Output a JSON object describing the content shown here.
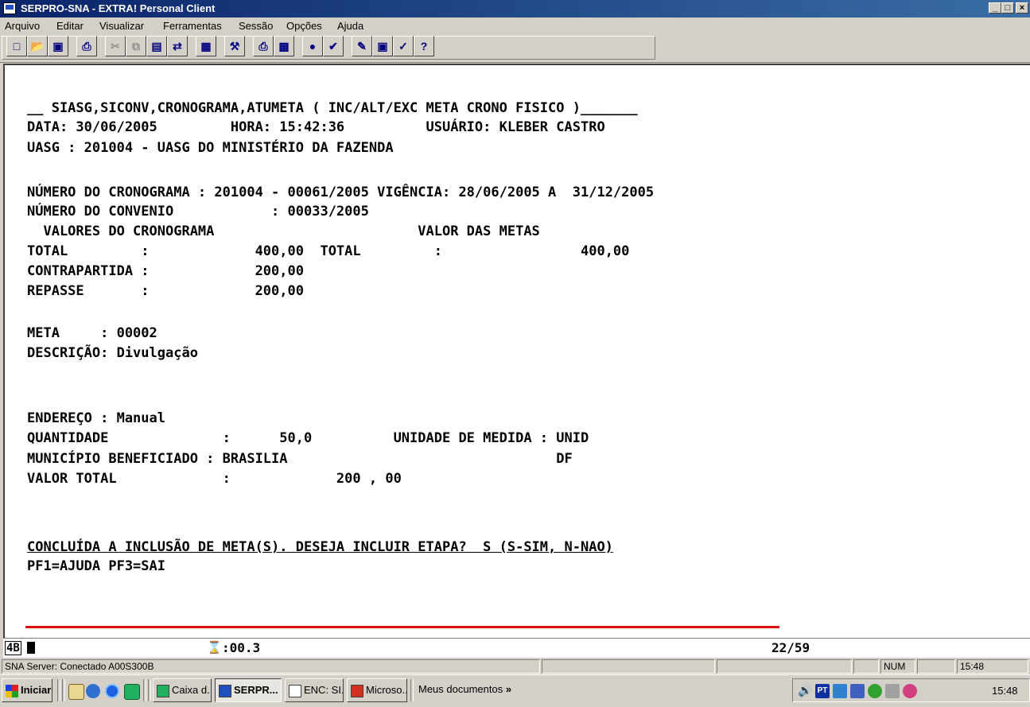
{
  "window": {
    "title": "SERPRO-SNA - EXTRA! Personal Client",
    "min": "_",
    "max": "□",
    "close": "×"
  },
  "menu": [
    "Arquivo",
    "Editar",
    "Visualizar",
    "Ferramentas",
    "Sessão",
    "Opções",
    "Ajuda"
  ],
  "toolbar_icons": [
    "new-icon",
    "open-icon",
    "save-icon",
    "print-icon",
    "cut-icon",
    "copy-icon",
    "paste-icon",
    "transfer-icon",
    "clipboard-icon",
    "settings-icon",
    "printer-setup-icon",
    "macro-icon",
    "record-icon",
    "quickpad-icon",
    "edit-icon",
    "chart-icon",
    "properties-icon",
    "help-icon"
  ],
  "screen": {
    "l01": "__ SIASG,SICONV,CRONOGRAMA,ATUMETA ( INC/ALT/EXC META CRONO FISICO )_______",
    "l02": "DATA: 30/06/2005         HORA: 15:42:36          USUÁRIO: KLEBER CASTRO",
    "l03": "UASG : 201004 - UASG DO MINISTÉRIO DA FAZENDA",
    "l05": "NÚMERO DO CRONOGRAMA : 201004 - 00061/2005 VIGÊNCIA: 28/06/2005 A  31/12/2005",
    "l06": "NÚMERO DO CONVENIO            : 00033/2005",
    "l07": "  VALORES DO CRONOGRAMA                         VALOR DAS METAS",
    "l08": "TOTAL         :             400,00  TOTAL         :                 400,00",
    "l09": "CONTRAPARTIDA :             200,00",
    "l10": "REPASSE       :             200,00",
    "l12": "META     : 00002",
    "l13": "DESCRIÇÃO: Divulgação",
    "l17": "ENDEREÇO : Manual",
    "l18": "QUANTIDADE              :      50,0          UNIDADE DE MEDIDA : UNID",
    "l19": "MUNICÍPIO BENEFICIADO : BRASILIA                                 DF",
    "l20": "VALOR TOTAL             :             200 , 00",
    "l23": "CONCLUÍDA A INCLUSÃO DE META(S). DESEJA INCLUIR ETAPA?  S (S-SIM, N-NAO)",
    "l24": "PF1=AJUDA PF3=SAI"
  },
  "oia": {
    "left": "4B",
    "timer": ":00.3",
    "position": "22/59"
  },
  "statusbar": {
    "connection": "SNA Server: Conectado A00S300B",
    "num": "NUM",
    "time": "15:48"
  },
  "taskbar": {
    "start": "Iniciar",
    "tasks": [
      "Caixa d...",
      "SERPR...",
      "ENC: SI...",
      "Microso..."
    ],
    "docs": "Meus documentos",
    "docs_more": "»",
    "lang": "PT",
    "clock": "15:48"
  }
}
